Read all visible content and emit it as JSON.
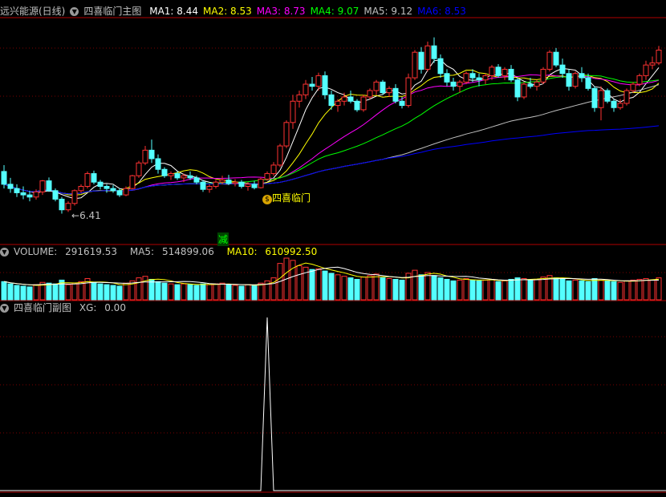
{
  "header": {
    "stock_title": "远兴能源(日线)",
    "indicator_name": "四喜临门主图",
    "ma": [
      {
        "label": "MA1:",
        "value": "8.44",
        "color": "#ffffff"
      },
      {
        "label": "MA2:",
        "value": "8.53",
        "color": "#ffff00"
      },
      {
        "label": "MA3:",
        "value": "8.73",
        "color": "#ff00ff"
      },
      {
        "label": "MA4:",
        "value": "9.07",
        "color": "#00ff00"
      },
      {
        "label": "MA5:",
        "value": "9.12",
        "color": "#c0c0c0"
      },
      {
        "label": "MA6:",
        "value": "8.53",
        "color": "#0000ff"
      }
    ]
  },
  "annotations": {
    "low_price": "6.41",
    "signal_label": "四喜临门",
    "signal_icon": "money-bag-icon",
    "reduce_mark": "减"
  },
  "volume_header": {
    "volume": {
      "label": "VOLUME:",
      "value": "291619.53"
    },
    "ma5": {
      "label": "MA5:",
      "value": "514899.06"
    },
    "ma10": {
      "label": "MA10:",
      "value": "610992.50"
    }
  },
  "sub_header": {
    "name": "四喜临门副图",
    "xg": {
      "label": "XG:",
      "value": "0.00"
    }
  },
  "colors": {
    "up": "#ff3232",
    "down": "#54ffff",
    "panel_border": "#b00000",
    "grid": "#7a0000"
  },
  "chart_data": [
    {
      "type": "candlestick",
      "title": "四喜临门主图",
      "x": [
        1,
        2,
        3,
        4,
        5,
        6,
        7,
        8,
        9,
        10,
        11,
        12,
        13,
        14,
        15,
        16,
        17,
        18,
        19,
        20,
        21,
        22,
        23,
        24,
        25,
        26,
        27,
        28,
        29,
        30,
        31,
        32,
        33,
        34,
        35,
        36,
        37,
        38,
        39,
        40,
        41,
        42,
        43,
        44,
        45,
        46,
        47,
        48,
        49,
        50,
        51,
        52,
        53,
        54,
        55,
        56,
        57,
        58,
        59,
        60,
        61,
        62,
        63,
        64,
        65,
        66,
        67,
        68,
        69,
        70,
        71,
        72,
        73,
        74,
        75,
        76,
        77,
        78,
        79,
        80,
        81,
        82,
        83,
        84,
        85,
        86,
        87,
        88,
        89,
        90,
        91,
        92,
        93,
        94,
        95,
        96,
        97,
        98,
        99,
        100,
        101,
        102,
        103
      ],
      "ohlc": [
        [
          7.4,
          7.55,
          7.0,
          7.1
        ],
        [
          7.1,
          7.25,
          6.9,
          7.0
        ],
        [
          7.0,
          7.1,
          6.8,
          6.9
        ],
        [
          6.9,
          7.05,
          6.75,
          6.85
        ],
        [
          6.85,
          6.95,
          6.7,
          6.8
        ],
        [
          6.8,
          6.98,
          6.74,
          6.92
        ],
        [
          6.92,
          7.2,
          6.85,
          7.18
        ],
        [
          7.18,
          7.26,
          6.92,
          6.95
        ],
        [
          6.95,
          7.0,
          6.7,
          6.75
        ],
        [
          6.75,
          6.8,
          6.41,
          6.5
        ],
        [
          6.5,
          6.7,
          6.45,
          6.65
        ],
        [
          6.65,
          6.98,
          6.6,
          6.95
        ],
        [
          6.95,
          7.1,
          6.9,
          7.05
        ],
        [
          7.05,
          7.4,
          7.0,
          7.35
        ],
        [
          7.35,
          7.42,
          7.1,
          7.15
        ],
        [
          7.15,
          7.2,
          6.98,
          7.05
        ],
        [
          7.05,
          7.1,
          6.9,
          7.0
        ],
        [
          7.0,
          7.08,
          6.9,
          6.95
        ],
        [
          6.95,
          7.0,
          6.8,
          6.85
        ],
        [
          6.85,
          7.05,
          6.82,
          7.0
        ],
        [
          7.0,
          7.32,
          6.98,
          7.3
        ],
        [
          7.3,
          7.65,
          7.25,
          7.6
        ],
        [
          7.6,
          8.0,
          7.55,
          7.9
        ],
        [
          7.9,
          8.15,
          7.6,
          7.7
        ],
        [
          7.7,
          7.8,
          7.35,
          7.45
        ],
        [
          7.45,
          7.5,
          7.25,
          7.3
        ],
        [
          7.3,
          7.4,
          7.2,
          7.35
        ],
        [
          7.35,
          7.4,
          7.2,
          7.25
        ],
        [
          7.25,
          7.35,
          7.15,
          7.3
        ],
        [
          7.3,
          7.4,
          7.2,
          7.25
        ],
        [
          7.25,
          7.3,
          7.1,
          7.15
        ],
        [
          7.15,
          7.2,
          6.92,
          6.98
        ],
        [
          6.98,
          7.1,
          6.9,
          7.05
        ],
        [
          7.05,
          7.2,
          7.0,
          7.15
        ],
        [
          7.15,
          7.3,
          7.1,
          7.2
        ],
        [
          7.2,
          7.32,
          7.08,
          7.12
        ],
        [
          7.12,
          7.22,
          7.05,
          7.15
        ],
        [
          7.15,
          7.2,
          7.0,
          7.05
        ],
        [
          7.05,
          7.15,
          6.95,
          7.1
        ],
        [
          7.1,
          7.18,
          6.98,
          7.02
        ],
        [
          7.02,
          7.25,
          7.0,
          7.22
        ],
        [
          7.22,
          7.4,
          7.18,
          7.35
        ],
        [
          7.35,
          7.62,
          7.3,
          7.55
        ],
        [
          7.55,
          8.05,
          7.5,
          8.0
        ],
        [
          8.0,
          8.6,
          7.95,
          8.55
        ],
        [
          8.55,
          9.2,
          8.4,
          9.05
        ],
        [
          9.05,
          9.3,
          8.9,
          9.2
        ],
        [
          9.2,
          9.55,
          9.1,
          9.45
        ],
        [
          9.45,
          9.62,
          9.3,
          9.4
        ],
        [
          9.4,
          9.72,
          9.3,
          9.65
        ],
        [
          9.65,
          9.75,
          9.1,
          9.2
        ],
        [
          9.2,
          9.3,
          8.85,
          8.95
        ],
        [
          8.95,
          9.1,
          8.8,
          9.05
        ],
        [
          9.05,
          9.25,
          8.95,
          9.15
        ],
        [
          9.15,
          9.3,
          9.0,
          9.05
        ],
        [
          9.05,
          9.1,
          8.8,
          8.85
        ],
        [
          8.85,
          9.2,
          8.8,
          9.15
        ],
        [
          9.15,
          9.35,
          9.1,
          9.3
        ],
        [
          9.3,
          9.55,
          9.2,
          9.5
        ],
        [
          9.5,
          9.55,
          9.2,
          9.25
        ],
        [
          9.25,
          9.4,
          9.15,
          9.35
        ],
        [
          9.35,
          9.45,
          9.0,
          9.05
        ],
        [
          9.05,
          9.15,
          8.88,
          8.95
        ],
        [
          8.95,
          9.7,
          8.9,
          9.6
        ],
        [
          9.6,
          10.25,
          9.55,
          10.2
        ],
        [
          10.2,
          10.32,
          9.7,
          9.8
        ],
        [
          9.8,
          10.45,
          9.75,
          10.35
        ],
        [
          10.35,
          10.55,
          9.95,
          10.05
        ],
        [
          10.05,
          10.15,
          9.6,
          9.7
        ],
        [
          9.7,
          9.8,
          9.4,
          9.5
        ],
        [
          9.5,
          9.6,
          9.3,
          9.4
        ],
        [
          9.4,
          9.55,
          9.25,
          9.5
        ],
        [
          9.5,
          9.75,
          9.45,
          9.7
        ],
        [
          9.7,
          9.8,
          9.5,
          9.6
        ],
        [
          9.6,
          9.7,
          9.4,
          9.55
        ],
        [
          9.55,
          9.7,
          9.45,
          9.65
        ],
        [
          9.65,
          9.9,
          9.55,
          9.85
        ],
        [
          9.85,
          9.92,
          9.6,
          9.65
        ],
        [
          9.65,
          9.85,
          9.55,
          9.8
        ],
        [
          9.8,
          9.9,
          9.5,
          9.55
        ],
        [
          9.55,
          9.6,
          9.05,
          9.15
        ],
        [
          9.15,
          9.5,
          9.1,
          9.45
        ],
        [
          9.45,
          9.6,
          9.35,
          9.4
        ],
        [
          9.4,
          9.55,
          9.3,
          9.5
        ],
        [
          9.5,
          9.85,
          9.45,
          9.8
        ],
        [
          9.8,
          10.25,
          9.75,
          10.2
        ],
        [
          10.2,
          10.3,
          9.85,
          9.9
        ],
        [
          9.9,
          10.05,
          9.6,
          9.7
        ],
        [
          9.7,
          9.8,
          9.3,
          9.4
        ],
        [
          9.4,
          9.75,
          9.35,
          9.7
        ],
        [
          9.7,
          9.85,
          9.5,
          9.6
        ],
        [
          9.6,
          9.7,
          9.3,
          9.35
        ],
        [
          9.35,
          9.4,
          8.8,
          8.9
        ],
        [
          8.9,
          9.4,
          8.6,
          9.3
        ],
        [
          9.3,
          9.35,
          9.0,
          9.05
        ],
        [
          9.05,
          9.1,
          8.8,
          8.9
        ],
        [
          8.9,
          9.1,
          8.85,
          9.0
        ],
        [
          9.0,
          9.35,
          8.95,
          9.3
        ],
        [
          9.3,
          9.5,
          9.25,
          9.45
        ],
        [
          9.45,
          9.7,
          9.4,
          9.65
        ],
        [
          9.65,
          10.0,
          9.55,
          9.9
        ],
        [
          9.9,
          10.1,
          9.8,
          9.95
        ],
        [
          9.95,
          10.35,
          9.9,
          10.25
        ]
      ],
      "series": [
        {
          "name": "MA1",
          "color": "#ffffff",
          "period": 5
        },
        {
          "name": "MA2",
          "color": "#ffff00",
          "period": 10
        },
        {
          "name": "MA3",
          "color": "#ff00ff",
          "period": 20
        },
        {
          "name": "MA4",
          "color": "#00ff00",
          "period": 30
        },
        {
          "name": "MA5",
          "color": "#c0c0c0",
          "period": 60
        },
        {
          "name": "MA6",
          "color": "#0000ff",
          "period": 120
        }
      ],
      "ylim": [
        6.25,
        10.9
      ],
      "signal_index": 41,
      "low_index": 10,
      "reduce_index": 34
    },
    {
      "type": "bar",
      "title": "VOLUME",
      "values": [
        48,
        42,
        38,
        36,
        34,
        40,
        46,
        44,
        42,
        52,
        40,
        44,
        48,
        56,
        46,
        42,
        40,
        38,
        36,
        44,
        50,
        58,
        62,
        54,
        48,
        44,
        42,
        40,
        42,
        40,
        38,
        42,
        40,
        42,
        44,
        40,
        38,
        36,
        40,
        38,
        44,
        50,
        58,
        96,
        110,
        104,
        90,
        86,
        80,
        82,
        76,
        70,
        66,
        62,
        58,
        54,
        60,
        64,
        68,
        58,
        56,
        54,
        52,
        70,
        78,
        66,
        72,
        64,
        58,
        54,
        50,
        52,
        56,
        52,
        50,
        52,
        54,
        48,
        50,
        54,
        58,
        56,
        52,
        54,
        60,
        64,
        58,
        54,
        50,
        52,
        50,
        48,
        56,
        52,
        50,
        48,
        46,
        50,
        52,
        54,
        56,
        52,
        58
      ],
      "series": [
        {
          "name": "MA5",
          "color": "#ffff00"
        },
        {
          "name": "MA10",
          "color": "#ffffff"
        }
      ]
    },
    {
      "type": "line",
      "title": "四喜临门副图",
      "series": [
        {
          "name": "XG",
          "color": "#ffffff"
        }
      ],
      "signal_index": 41,
      "ylim": [
        0,
        1
      ]
    }
  ]
}
